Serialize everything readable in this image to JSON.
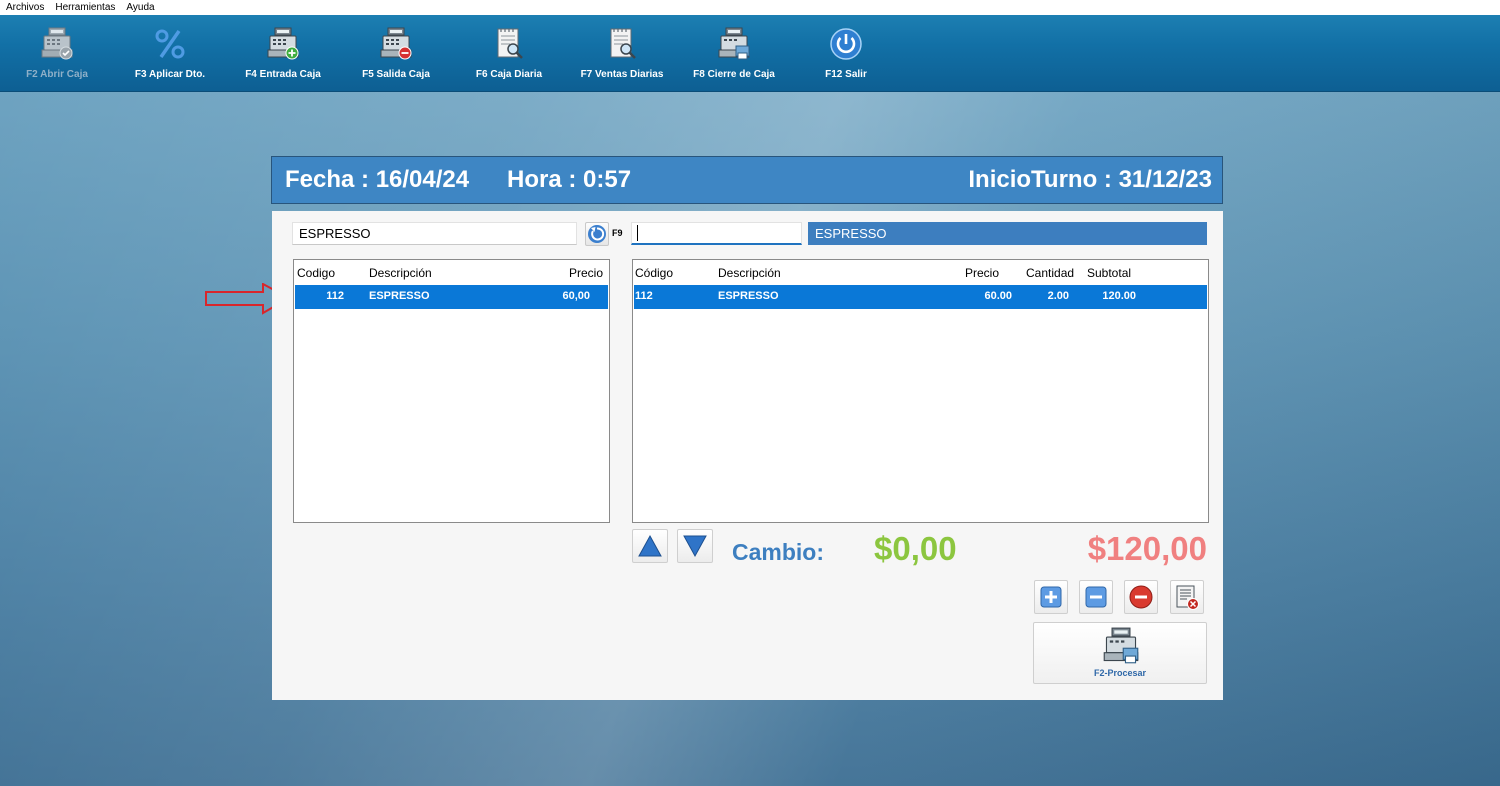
{
  "menu": [
    "Archivos",
    "Herramientas",
    "Ayuda"
  ],
  "toolbar": [
    {
      "label": "F2 Abrir Caja",
      "icon": "cash-register-check-icon",
      "enabled": false
    },
    {
      "label": "F3 Aplicar Dto.",
      "icon": "percent-icon",
      "enabled": true
    },
    {
      "label": "F4 Entrada Caja",
      "icon": "cash-register-add-icon",
      "enabled": true
    },
    {
      "label": "F5 Salida Caja",
      "icon": "cash-register-remove-icon",
      "enabled": true
    },
    {
      "label": "F6 Caja Diaria",
      "icon": "report-search-icon",
      "enabled": true
    },
    {
      "label": "F7 Ventas Diarias",
      "icon": "report-search-icon",
      "enabled": true
    },
    {
      "label": "F8 Cierre de Caja",
      "icon": "cash-register-print-icon",
      "enabled": true
    },
    {
      "label": "F12 Salir",
      "icon": "power-icon",
      "enabled": true
    }
  ],
  "header": {
    "fecha": "Fecha : 16/04/24",
    "hora": "Hora :  0:57",
    "inicio_turno": "InicioTurno : 31/12/23"
  },
  "search": {
    "product_value": "ESPRESSO",
    "f9_label": "F9",
    "quantity_value": "",
    "selected_product": "ESPRESSO"
  },
  "product_list": {
    "columns": [
      "Codigo",
      "Descripción",
      "Precio"
    ],
    "rows": [
      {
        "codigo": "112",
        "descripcion": "ESPRESSO",
        "precio": "60,00"
      }
    ]
  },
  "cart": {
    "columns": [
      "Código",
      "Descripción",
      "Precio",
      "Cantidad",
      "Subtotal"
    ],
    "rows": [
      {
        "codigo": "112",
        "descripcion": "ESPRESSO",
        "precio": "60.00",
        "cantidad": "2.00",
        "subtotal": "120.00"
      }
    ]
  },
  "totals": {
    "cambio_label": "Cambio:",
    "cambio_value": "$0,00",
    "total_value": "$120,00"
  },
  "actions": {
    "procesar_label": "F2-Procesar"
  },
  "colors": {
    "toolbar": "#1270a6",
    "header": "#3e86c4",
    "selection": "#0a78d7",
    "cambio_label": "#3d7fc0",
    "cambio_value": "#8cc63f",
    "total_value": "#f08080"
  }
}
